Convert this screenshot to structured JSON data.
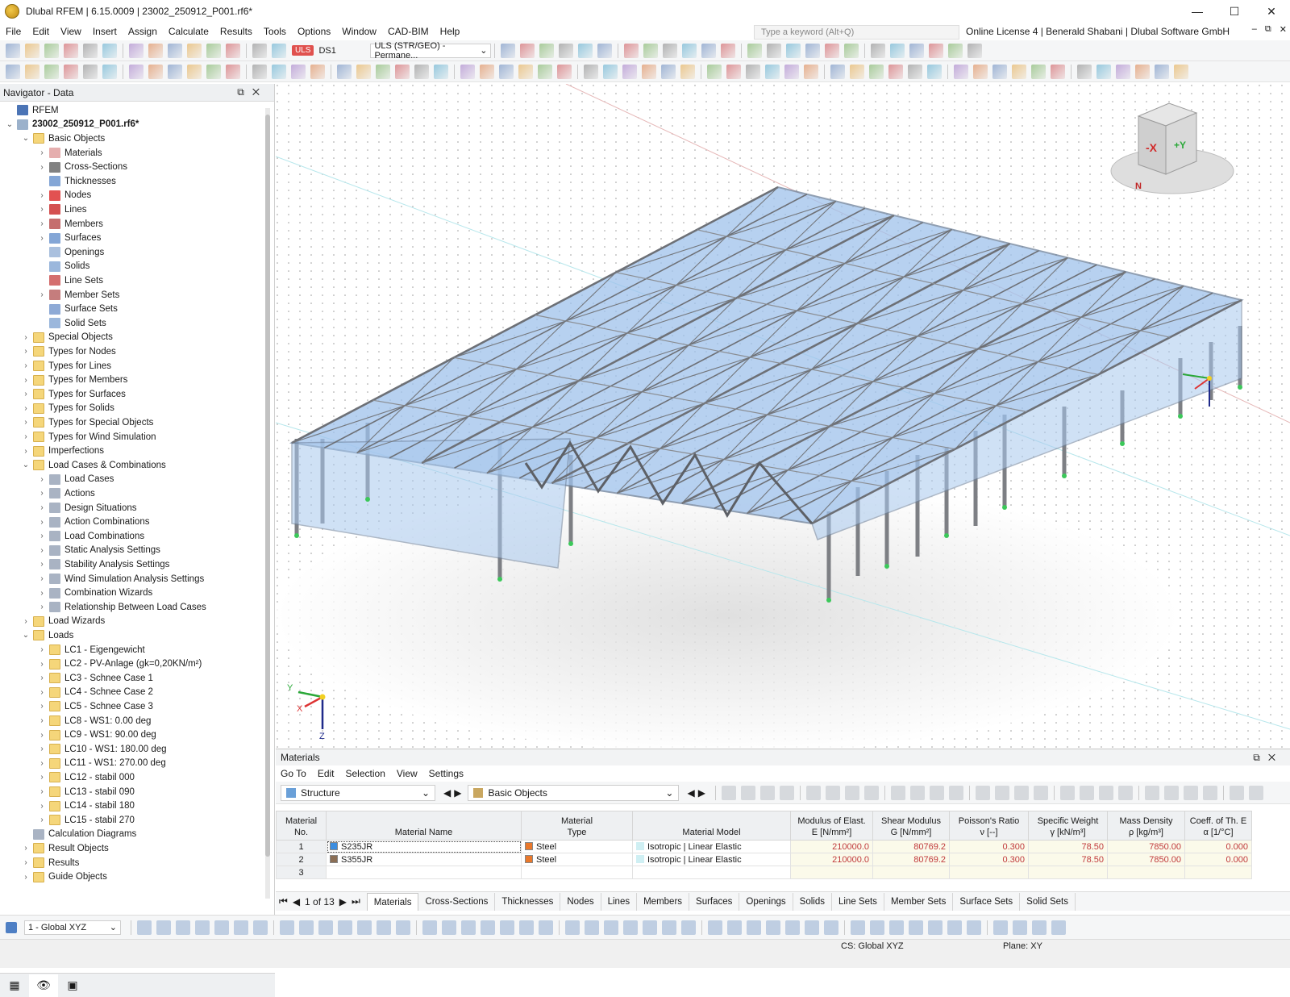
{
  "window": {
    "title": "Dlubal RFEM | 6.15.0009 | 23002_250912_P001.rf6*"
  },
  "menu": [
    "File",
    "Edit",
    "View",
    "Insert",
    "Assign",
    "Calculate",
    "Results",
    "Tools",
    "Options",
    "Window",
    "CAD-BIM",
    "Help"
  ],
  "search": {
    "placeholder": "Type a keyword (Alt+Q)"
  },
  "license": "Online License 4 | Benerald Shabani | Dlubal Software GmbH",
  "loadcase": {
    "type": "ULS",
    "name": "DS1",
    "combo": "ULS (STR/GEO) - Permane..."
  },
  "navigator": {
    "title": "Navigator - Data",
    "items": [
      {
        "label": "RFEM",
        "level": 0,
        "exp": "",
        "icon": "rfem-icon"
      },
      {
        "label": "23002_250912_P001.rf6*",
        "level": 0,
        "exp": "v",
        "icon": "file-icon"
      },
      {
        "label": "Basic Objects",
        "level": 1,
        "exp": "v",
        "icon": "folder-icon"
      },
      {
        "label": "Materials",
        "level": 2,
        "exp": ">",
        "icon": "materials-icon"
      },
      {
        "label": "Cross-Sections",
        "level": 2,
        "exp": ">",
        "icon": "cross-section-icon"
      },
      {
        "label": "Thicknesses",
        "level": 2,
        "exp": "",
        "icon": "thickness-icon"
      },
      {
        "label": "Nodes",
        "level": 2,
        "exp": ">",
        "icon": "node-icon"
      },
      {
        "label": "Lines",
        "level": 2,
        "exp": ">",
        "icon": "line-icon"
      },
      {
        "label": "Members",
        "level": 2,
        "exp": ">",
        "icon": "member-icon"
      },
      {
        "label": "Surfaces",
        "level": 2,
        "exp": ">",
        "icon": "surface-icon"
      },
      {
        "label": "Openings",
        "level": 2,
        "exp": "",
        "icon": "opening-icon"
      },
      {
        "label": "Solids",
        "level": 2,
        "exp": "",
        "icon": "solid-icon"
      },
      {
        "label": "Line Sets",
        "level": 2,
        "exp": "",
        "icon": "line-set-icon"
      },
      {
        "label": "Member Sets",
        "level": 2,
        "exp": ">",
        "icon": "member-set-icon"
      },
      {
        "label": "Surface Sets",
        "level": 2,
        "exp": "",
        "icon": "surface-set-icon"
      },
      {
        "label": "Solid Sets",
        "level": 2,
        "exp": "",
        "icon": "solid-set-icon"
      },
      {
        "label": "Special Objects",
        "level": 1,
        "exp": ">",
        "icon": "folder-icon"
      },
      {
        "label": "Types for Nodes",
        "level": 1,
        "exp": ">",
        "icon": "folder-icon"
      },
      {
        "label": "Types for Lines",
        "level": 1,
        "exp": ">",
        "icon": "folder-icon"
      },
      {
        "label": "Types for Members",
        "level": 1,
        "exp": ">",
        "icon": "folder-icon"
      },
      {
        "label": "Types for Surfaces",
        "level": 1,
        "exp": ">",
        "icon": "folder-icon"
      },
      {
        "label": "Types for Solids",
        "level": 1,
        "exp": ">",
        "icon": "folder-icon"
      },
      {
        "label": "Types for Special Objects",
        "level": 1,
        "exp": ">",
        "icon": "folder-icon"
      },
      {
        "label": "Types for Wind Simulation",
        "level": 1,
        "exp": ">",
        "icon": "folder-icon"
      },
      {
        "label": "Imperfections",
        "level": 1,
        "exp": ">",
        "icon": "folder-icon"
      },
      {
        "label": "Load Cases & Combinations",
        "level": 1,
        "exp": "v",
        "icon": "folder-icon"
      },
      {
        "label": "Load Cases",
        "level": 2,
        "exp": ">",
        "icon": "load-case-icon"
      },
      {
        "label": "Actions",
        "level": 2,
        "exp": ">",
        "icon": "action-icon"
      },
      {
        "label": "Design Situations",
        "level": 2,
        "exp": ">",
        "icon": "design-situation-icon"
      },
      {
        "label": "Action Combinations",
        "level": 2,
        "exp": ">",
        "icon": "action-combination-icon"
      },
      {
        "label": "Load Combinations",
        "level": 2,
        "exp": ">",
        "icon": "load-combination-icon"
      },
      {
        "label": "Static Analysis Settings",
        "level": 2,
        "exp": ">",
        "icon": "static-analysis-icon"
      },
      {
        "label": "Stability Analysis Settings",
        "level": 2,
        "exp": ">",
        "icon": "stability-analysis-icon"
      },
      {
        "label": "Wind Simulation Analysis Settings",
        "level": 2,
        "exp": ">",
        "icon": "wind-simulation-icon"
      },
      {
        "label": "Combination Wizards",
        "level": 2,
        "exp": ">",
        "icon": "combination-wizard-icon"
      },
      {
        "label": "Relationship Between Load Cases",
        "level": 2,
        "exp": ">",
        "icon": "relationship-icon"
      },
      {
        "label": "Load Wizards",
        "level": 1,
        "exp": ">",
        "icon": "folder-icon"
      },
      {
        "label": "Loads",
        "level": 1,
        "exp": "v",
        "icon": "folder-icon"
      },
      {
        "label": "LC1 - Eigengewicht",
        "level": 2,
        "exp": ">",
        "icon": "folder-icon"
      },
      {
        "label": "LC2 - PV-Anlage (gk=0,20KN/m²)",
        "level": 2,
        "exp": ">",
        "icon": "folder-icon"
      },
      {
        "label": "LC3 - Schnee Case 1",
        "level": 2,
        "exp": ">",
        "icon": "folder-icon"
      },
      {
        "label": "LC4 - Schnee Case 2",
        "level": 2,
        "exp": ">",
        "icon": "folder-icon"
      },
      {
        "label": "LC5 - Schnee Case 3",
        "level": 2,
        "exp": ">",
        "icon": "folder-icon"
      },
      {
        "label": "LC8 - WS1: 0.00 deg",
        "level": 2,
        "exp": ">",
        "icon": "folder-icon"
      },
      {
        "label": "LC9 - WS1: 90.00 deg",
        "level": 2,
        "exp": ">",
        "icon": "folder-icon"
      },
      {
        "label": "LC10 - WS1: 180.00 deg",
        "level": 2,
        "exp": ">",
        "icon": "folder-icon"
      },
      {
        "label": "LC11 - WS1: 270.00 deg",
        "level": 2,
        "exp": ">",
        "icon": "folder-icon"
      },
      {
        "label": "LC12 - stabil 000",
        "level": 2,
        "exp": ">",
        "icon": "folder-icon"
      },
      {
        "label": "LC13 - stabil 090",
        "level": 2,
        "exp": ">",
        "icon": "folder-icon"
      },
      {
        "label": "LC14 - stabil 180",
        "level": 2,
        "exp": ">",
        "icon": "folder-icon"
      },
      {
        "label": "LC15 - stabil 270",
        "level": 2,
        "exp": ">",
        "icon": "folder-icon"
      },
      {
        "label": "Calculation Diagrams",
        "level": 1,
        "exp": "",
        "icon": "calculation-diagram-icon"
      },
      {
        "label": "Result Objects",
        "level": 1,
        "exp": ">",
        "icon": "folder-icon"
      },
      {
        "label": "Results",
        "level": 1,
        "exp": ">",
        "icon": "folder-icon"
      },
      {
        "label": "Guide Objects",
        "level": 1,
        "exp": ">",
        "icon": "folder-icon"
      }
    ]
  },
  "view_axes": {
    "x": "X",
    "y": "Y",
    "z": "Z"
  },
  "viewcube": {
    "neg_x": "-X",
    "pos_y": "+Y",
    "north": "N"
  },
  "materials": {
    "title": "Materials",
    "menu": [
      "Go To",
      "Edit",
      "Selection",
      "View",
      "Settings"
    ],
    "filter_structure": "Structure",
    "filter_objects": "Basic Objects",
    "columns": [
      {
        "top": "Material",
        "bottom": "No."
      },
      {
        "top": "",
        "bottom": "Material Name"
      },
      {
        "top": "Material",
        "bottom": "Type"
      },
      {
        "top": "",
        "bottom": "Material Model"
      },
      {
        "top": "Modulus of Elast.",
        "bottom": "E [N/mm²]"
      },
      {
        "top": "Shear Modulus",
        "bottom": "G [N/mm²]"
      },
      {
        "top": "Poisson's Ratio",
        "bottom": "ν [--]"
      },
      {
        "top": "Specific Weight",
        "bottom": "γ [kN/m³]"
      },
      {
        "top": "Mass Density",
        "bottom": "ρ [kg/m³]"
      },
      {
        "top": "Coeff. of Th. E",
        "bottom": "α [1/°C]"
      }
    ],
    "rows": [
      {
        "no": "1",
        "name": "S235JR",
        "name_color": "#3b8de0",
        "type": "Steel",
        "type_color": "#e9782b",
        "model": "Isotropic | Linear Elastic",
        "E": "210000.0",
        "G": "80769.2",
        "nu": "0.300",
        "gamma": "78.50",
        "rho": "7850.00",
        "alpha": "0.000"
      },
      {
        "no": "2",
        "name": "S355JR",
        "name_color": "#8a6e55",
        "type": "Steel",
        "type_color": "#e9782b",
        "model": "Isotropic | Linear Elastic",
        "E": "210000.0",
        "G": "80769.2",
        "nu": "0.300",
        "gamma": "78.50",
        "rho": "7850.00",
        "alpha": "0.000"
      },
      {
        "no": "3",
        "name": "",
        "name_color": "",
        "type": "",
        "type_color": "",
        "model": "",
        "E": "",
        "G": "",
        "nu": "",
        "gamma": "",
        "rho": "",
        "alpha": ""
      }
    ],
    "page": "1 of 13",
    "tabs": [
      "Materials",
      "Cross-Sections",
      "Thicknesses",
      "Nodes",
      "Lines",
      "Members",
      "Surfaces",
      "Openings",
      "Solids",
      "Line Sets",
      "Member Sets",
      "Surface Sets",
      "Solid Sets"
    ]
  },
  "bottom": {
    "coord_system": "1 - Global XYZ"
  },
  "status": {
    "cs": "CS: Global XYZ",
    "plane": "Plane: XY"
  }
}
